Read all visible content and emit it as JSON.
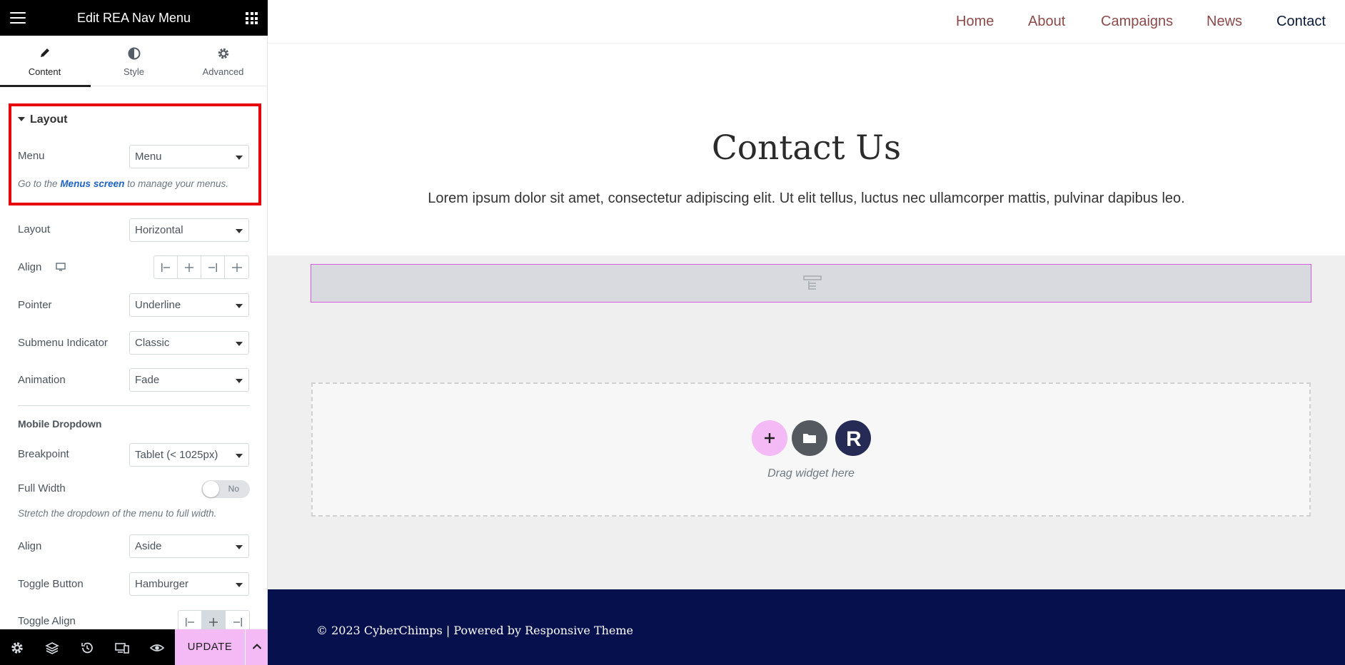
{
  "panel": {
    "title": "Edit REA Nav Menu",
    "tabs": [
      {
        "label": "Content",
        "icon": "pencil-icon"
      },
      {
        "label": "Style",
        "icon": "half-circle-icon"
      },
      {
        "label": "Advanced",
        "icon": "gear-icon"
      }
    ],
    "layout_section": {
      "title": "Layout",
      "menu_label": "Menu",
      "menu_value": "Menu",
      "help_prefix": "Go to the",
      "help_link": "Menus screen",
      "help_suffix": "to manage your menus."
    },
    "controls": {
      "layout": {
        "label": "Layout",
        "value": "Horizontal"
      },
      "align": {
        "label": "Align"
      },
      "pointer": {
        "label": "Pointer",
        "value": "Underline"
      },
      "submenu_indicator": {
        "label": "Submenu Indicator",
        "value": "Classic"
      },
      "animation": {
        "label": "Animation",
        "value": "Fade"
      }
    },
    "mobile_dropdown": {
      "heading": "Mobile Dropdown",
      "breakpoint": {
        "label": "Breakpoint",
        "value": "Tablet (< 1025px)"
      },
      "full_width": {
        "label": "Full Width",
        "toggle_text": "No",
        "help": "Stretch the dropdown of the menu to full width."
      },
      "align": {
        "label": "Align",
        "value": "Aside"
      },
      "toggle_button": {
        "label": "Toggle Button",
        "value": "Hamburger"
      },
      "toggle_align": {
        "label": "Toggle Align"
      }
    },
    "footer": {
      "update_label": "UPDATE",
      "icons": [
        "settings-icon",
        "layers-icon",
        "history-icon",
        "responsive-icon",
        "preview-eye-icon"
      ]
    },
    "colors": {
      "highlight": "#e5000b",
      "accent": "#f3baf5"
    }
  },
  "site": {
    "nav": [
      "Home",
      "About",
      "Campaigns",
      "News",
      "Contact"
    ],
    "hero_title": "Contact Us",
    "hero_text": "Lorem ipsum dolor sit amet, consectetur adipiscing elit. Ut elit tellus, luctus nec ullamcorper mattis, pulvinar dapibus leo.",
    "drop_zone_text": "Drag widget here",
    "footer_text": "© 2023 CyberChimps | Powered by Responsive Theme",
    "colors": {
      "nav": "#8d4a4a",
      "footer_bg": "#06104d",
      "selection": "#d75ce1"
    }
  }
}
